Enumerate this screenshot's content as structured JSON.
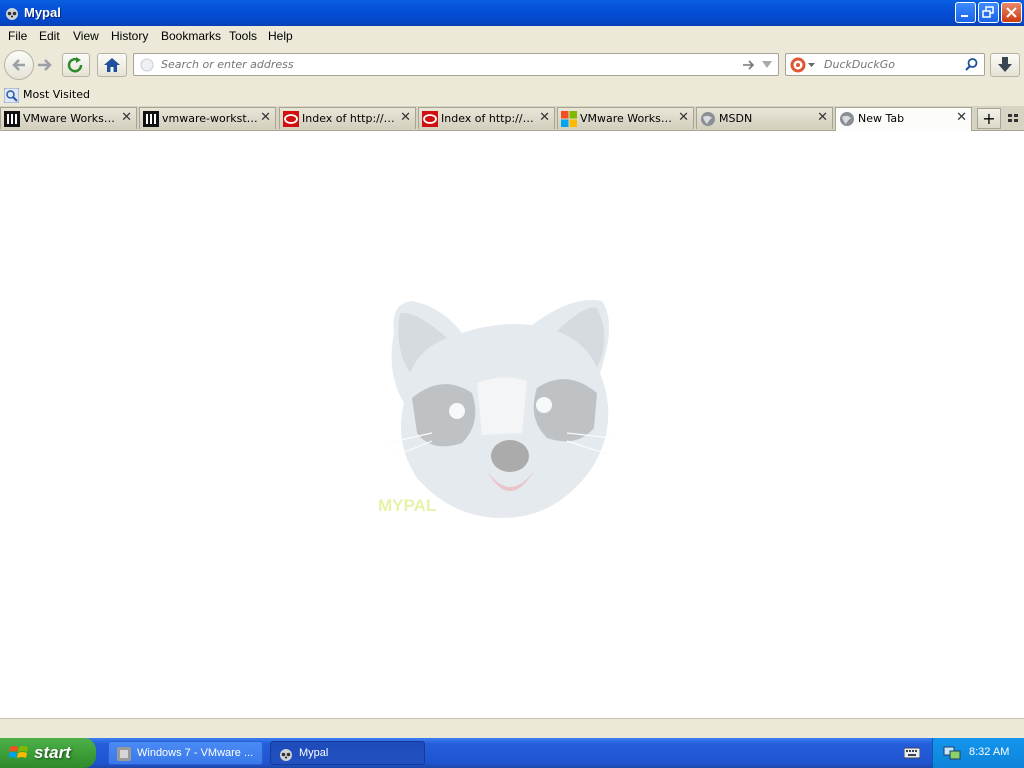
{
  "window": {
    "title": "Mypal"
  },
  "menu": [
    "File",
    "Edit",
    "View",
    "History",
    "Bookmarks",
    "Tools",
    "Help"
  ],
  "toolbar": {
    "url_placeholder": "Search or enter address",
    "search_placeholder": "DuckDuckGo"
  },
  "bookmarks": {
    "most_visited": "Most Visited"
  },
  "tabs": [
    {
      "label": "VMware Workstat...",
      "icon": "vmware-library-icon"
    },
    {
      "label": "vmware-workstati...",
      "icon": "vmware-library-icon"
    },
    {
      "label": "Index of http://d...",
      "icon": "red-o-icon"
    },
    {
      "label": "Index of http://d...",
      "icon": "red-o-icon"
    },
    {
      "label": "VMware Workstat...",
      "icon": "microsoft-icon"
    },
    {
      "label": "MSDN",
      "icon": "globe-icon"
    },
    {
      "label": "New Tab",
      "icon": "globe-icon",
      "active": true
    }
  ],
  "content": {
    "logo_text": "MYPAL"
  },
  "taskbar": {
    "start_label": "start",
    "tasks": [
      {
        "label": "Windows 7 - VMware ...",
        "icon": "vmware-icon"
      },
      {
        "label": "Mypal",
        "icon": "raccoon-icon",
        "active": true
      }
    ],
    "clock": "8:32 AM"
  },
  "colors": {
    "titlebar": "#0550d6",
    "taskbar": "#245edb",
    "start": "#3c9f38",
    "chrome": "#ece9d8"
  }
}
